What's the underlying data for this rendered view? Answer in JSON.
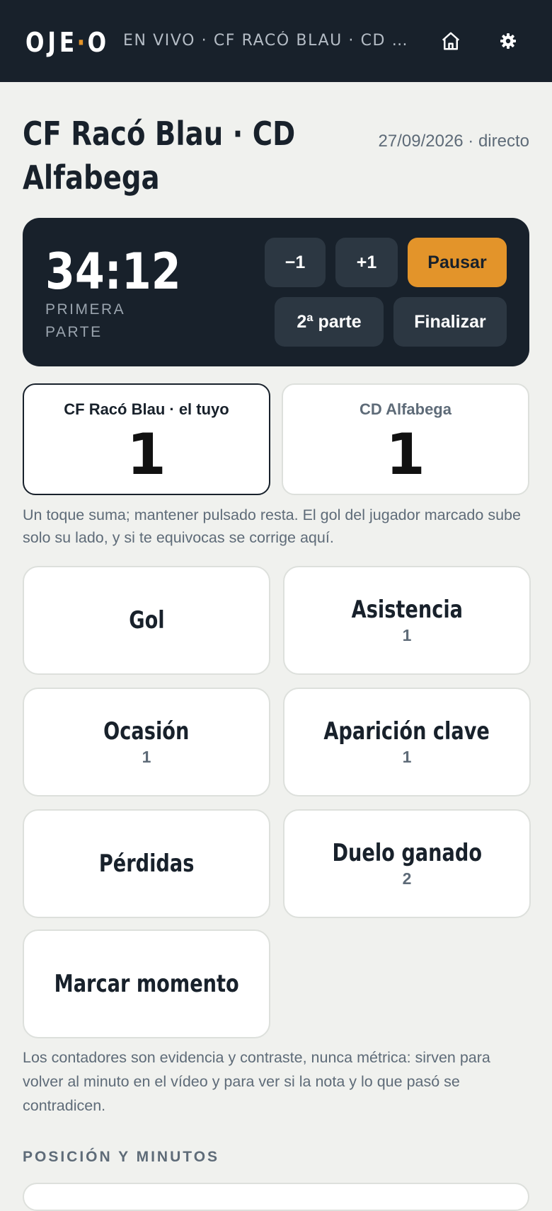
{
  "header": {
    "logo_left": "OJE",
    "logo_dot": "·",
    "logo_right": "O",
    "live_title": "EN VIVO · CF RACÓ BLAU · CD ALFABEGA",
    "home_icon": "home-icon",
    "settings_icon": "gear-icon"
  },
  "match": {
    "title": "CF Racó Blau · CD Alfabega",
    "date": "27/09/2026 · directo"
  },
  "timer": {
    "clock": "34:12",
    "period": "PRIMERA PARTE",
    "minus_label": "−1",
    "plus_label": "+1",
    "pause_label": "Pausar",
    "half_label": "2ª parte",
    "finish_label": "Finalizar"
  },
  "score": {
    "home": {
      "team": "CF Racó Blau · el tuyo",
      "goals": "1"
    },
    "away": {
      "team": "CD Alfabega",
      "goals": "1"
    }
  },
  "score_hint": "Un toque suma; mantener pulsado resta. El gol del jugador marcado sube solo su lado, y si te equivocas se corrige aquí.",
  "events": [
    {
      "label": "Gol",
      "count": ""
    },
    {
      "label": "Asistencia",
      "count": "1"
    },
    {
      "label": "Ocasión",
      "count": "1"
    },
    {
      "label": "Aparición clave",
      "count": "1"
    },
    {
      "label": "Pérdidas",
      "count": ""
    },
    {
      "label": "Duelo ganado",
      "count": "2"
    },
    {
      "label": "Marcar momento",
      "count": ""
    }
  ],
  "counters_note": "Los contadores son evidencia y contraste, nunca métrica: sirven para volver al minuto en el vídeo y para ver si la nota y lo que pasó se contradicen.",
  "section": {
    "position_minutes": "POSICIÓN Y MINUTOS"
  },
  "colors": {
    "dark": "#18212b",
    "accent": "#e3942a",
    "background": "#f0f1ee",
    "muted": "#5e6b78"
  }
}
